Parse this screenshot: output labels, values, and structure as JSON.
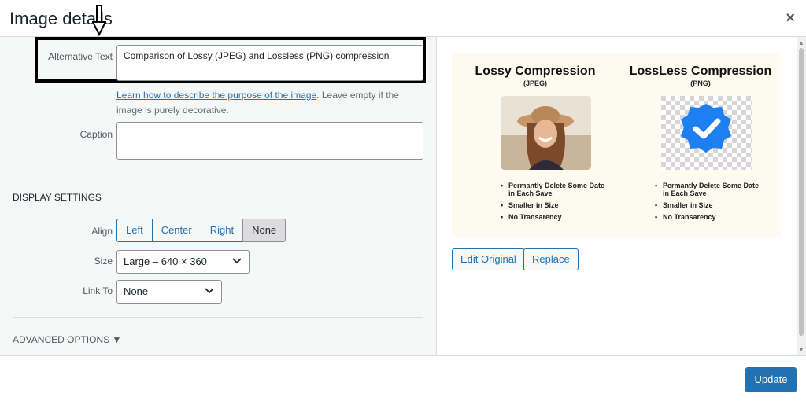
{
  "dialog": {
    "title": "Image details",
    "close_icon": "×"
  },
  "alt_text": {
    "label": "Alternative Text",
    "value": "Comparison of Lossy (JPEG) and Lossless (PNG) compression",
    "help_link": "Learn how to describe the purpose of the image",
    "help_text": ". Leave empty if the image is purely decorative."
  },
  "caption": {
    "label": "Caption",
    "value": ""
  },
  "display_settings": {
    "title": "DISPLAY SETTINGS",
    "align": {
      "label": "Align",
      "options": [
        "Left",
        "Center",
        "Right",
        "None"
      ],
      "selected": "None"
    },
    "size": {
      "label": "Size",
      "value": "Large – 640 × 360"
    },
    "link_to": {
      "label": "Link To",
      "value": "None"
    }
  },
  "advanced": {
    "label": "ADVANCED OPTIONS ▼"
  },
  "preview": {
    "lossy_title": "Lossy Compression",
    "lossy_sub": "(JPEG)",
    "lossless_title": "LossLess Compression",
    "lossless_sub": "(PNG)",
    "lossy_points": [
      "Permantly Delete Some Date  in Each Save",
      "Smaller in Size",
      "No Transarency"
    ],
    "lossless_points": [
      "Permantly Delete Some Date  in Each Save",
      "Smaller in Size",
      "No Transarency"
    ]
  },
  "actions": {
    "edit_original": "Edit Original",
    "replace": "Replace",
    "update": "Update"
  },
  "colors": {
    "accent": "#2271b1",
    "badge_blue": "#1e7ff0"
  }
}
